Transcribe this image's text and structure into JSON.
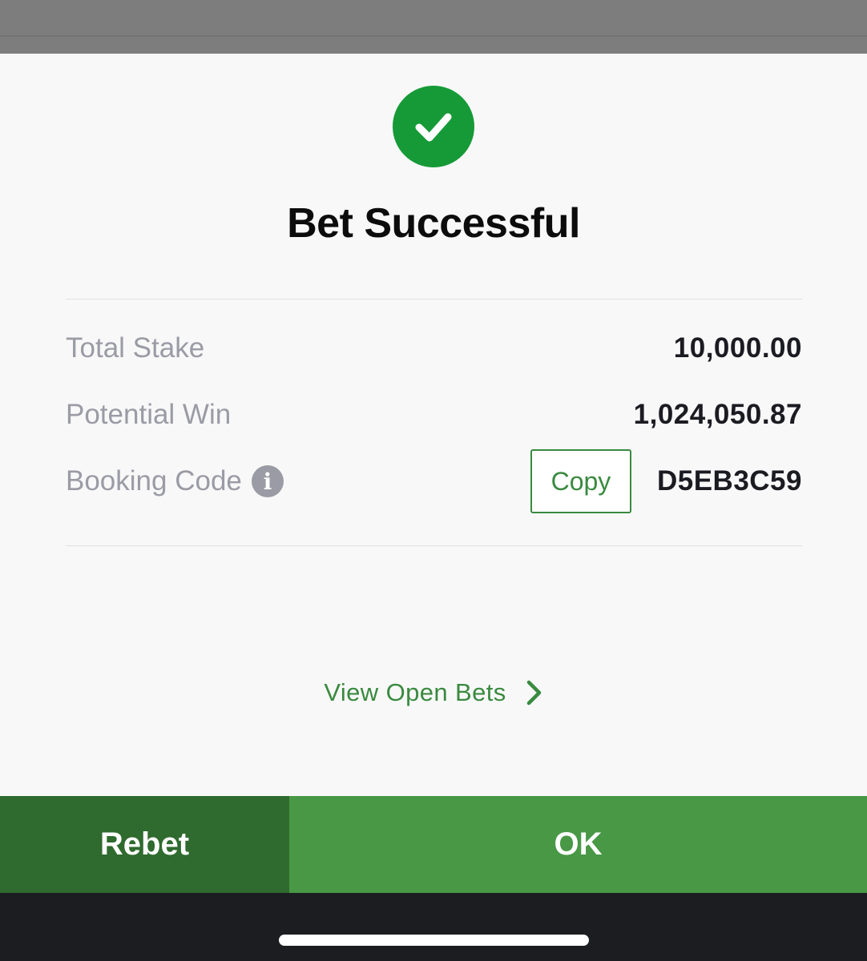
{
  "icons": {
    "success": "check-circle-icon",
    "info": "info-icon",
    "chevron": "chevron-right-icon"
  },
  "colors": {
    "success_green": "#169a37",
    "accent_green": "#3a8a3f",
    "rebet_bg": "#2f6a2e",
    "ok_bg": "#489846"
  },
  "dialog": {
    "title": "Bet Successful",
    "info_glyph": "i",
    "rows": [
      {
        "label": "Total Stake",
        "value": "10,000.00"
      },
      {
        "label": "Potential Win",
        "value": "1,024,050.87"
      },
      {
        "label": "Booking Code",
        "value": "D5EB3C59"
      }
    ],
    "copy_label": "Copy",
    "view_open_bets": "View Open Bets"
  },
  "footer": {
    "rebet_label": "Rebet",
    "ok_label": "OK"
  }
}
